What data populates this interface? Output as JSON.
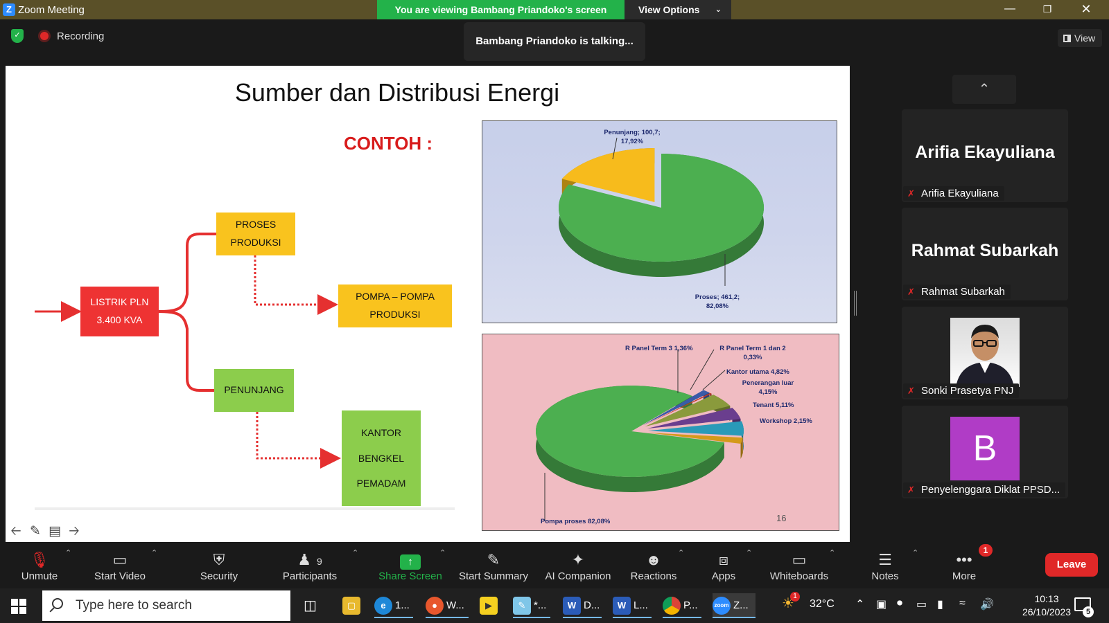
{
  "window": {
    "app_title": "Zoom Meeting",
    "viewing_banner": "You are viewing Bambang Priandoko's screen",
    "view_options": "View Options"
  },
  "topbar": {
    "recording_label": "Recording",
    "talking_notice": "Bambang Priandoko is talking...",
    "view_label": "View"
  },
  "slide": {
    "title": "Sumber dan Distribusi Energi",
    "example_label": "CONTOH  :",
    "boxes": {
      "source_line1": "LISTRIK PLN",
      "source_line2": "3.400 KVA",
      "process_line1": "PROSES",
      "process_line2": "PRODUKSI",
      "pumps_line1": "POMPA – POMPA",
      "pumps_line2": "PRODUKSI",
      "support": "PENUNJANG",
      "office": "KANTOR",
      "workshop": "BENGKEL",
      "firefighter": "PEMADAM"
    },
    "page_number": "16"
  },
  "chart_data": [
    {
      "type": "pie",
      "title": "",
      "slices": [
        {
          "label": "Proses; 461,2;",
          "percent_label": "82,08%",
          "value": 461.2,
          "percent": 82.08,
          "color": "#4caf50"
        },
        {
          "label": "Penunjang; 100,7;",
          "percent_label": "17,92%",
          "value": 100.7,
          "percent": 17.92,
          "color": "#f7bb1c"
        }
      ]
    },
    {
      "type": "pie",
      "title": "",
      "slices": [
        {
          "label": "Pompa proses 82,08%",
          "percent": 82.08,
          "color": "#4caf50"
        },
        {
          "label": "R Panel Term 3 1,36%",
          "percent": 1.36,
          "color": "#3a5aa8"
        },
        {
          "label": "R Panel Term 1 dan 2",
          "percent_label": "0,33%",
          "percent": 0.33,
          "color": "#c0392b"
        },
        {
          "label": "Kantor utama 4,82%",
          "percent": 4.82,
          "color": "#8a9a3c"
        },
        {
          "label": "Penerangan luar",
          "percent_label": "4,15%",
          "percent": 4.15,
          "color": "#6a3e8e"
        },
        {
          "label": "Tenant 5,11%",
          "percent": 5.11,
          "color": "#2a9ab8"
        },
        {
          "label": "Workshop 2,15%",
          "percent": 2.15,
          "color": "#d49a1a"
        }
      ]
    }
  ],
  "participants_panel": {
    "tiles": [
      {
        "display_name": "Arifia Ekayuliana",
        "name_tag": "Arifia Ekayuliana",
        "muted": true
      },
      {
        "display_name": "Rahmat Subarkah",
        "name_tag": "Rahmat Subarkah",
        "muted": true
      },
      {
        "name_tag": "Sonki Prasetya PNJ",
        "muted": true,
        "has_photo": true
      },
      {
        "avatar_letter": "B",
        "name_tag": "Penyelenggara Diklat PPSD...",
        "muted": true,
        "avatar_color": "#b03cc6"
      }
    ]
  },
  "toolbar": {
    "unmute": "Unmute",
    "start_video": "Start Video",
    "security": "Security",
    "participants": "Participants",
    "participants_count": "9",
    "share_screen": "Share Screen",
    "start_summary": "Start Summary",
    "ai_companion": "AI Companion",
    "reactions": "Reactions",
    "apps": "Apps",
    "whiteboards": "Whiteboards",
    "notes": "Notes",
    "more": "More",
    "more_badge": "1",
    "leave": "Leave"
  },
  "taskbar": {
    "search_placeholder": "Type here to search",
    "apps": [
      {
        "icon": "file-explorer-icon",
        "label": ""
      },
      {
        "icon": "edge-icon",
        "label": "1..."
      },
      {
        "icon": "firefox-icon",
        "label": "W..."
      },
      {
        "icon": "player-icon",
        "label": ""
      },
      {
        "icon": "notepad-icon",
        "label": "*..."
      },
      {
        "icon": "word-icon",
        "label": "D..."
      },
      {
        "icon": "word-icon",
        "label": "L..."
      },
      {
        "icon": "chrome-icon",
        "label": "P..."
      },
      {
        "icon": "zoom-icon",
        "label": "Z..."
      }
    ],
    "weather_temp": "32°C",
    "weather_badge": "1",
    "time": "10:13",
    "date": "26/10/2023",
    "notification_count": "5"
  }
}
